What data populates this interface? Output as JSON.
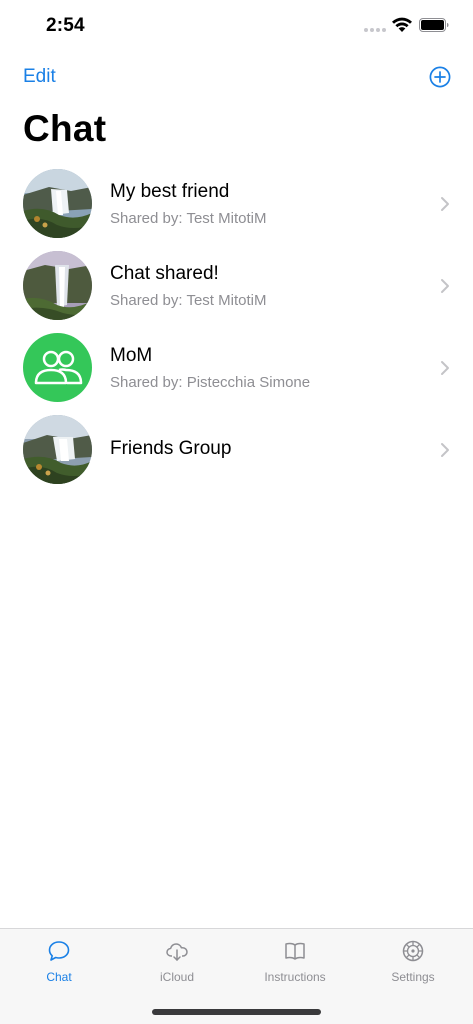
{
  "status_bar": {
    "time": "2:54"
  },
  "nav": {
    "edit_label": "Edit",
    "add_icon": "plus-circle-icon",
    "accent_color": "#1a80e6"
  },
  "title": "Chat",
  "chats": [
    {
      "name": "My best friend",
      "shared_by": "Shared by: Test MitotiM",
      "avatar": "waterfall-photo"
    },
    {
      "name": "Chat shared!",
      "shared_by": "Shared by: Test MitotiM",
      "avatar": "waterfall-photo"
    },
    {
      "name": "MoM",
      "shared_by": "Shared by: Pistecchia Simone",
      "avatar": "group-icon",
      "avatar_color": "#34c759"
    },
    {
      "name": "Friends Group",
      "shared_by": "",
      "avatar": "waterfall-photo"
    }
  ],
  "tabs": [
    {
      "label": "Chat",
      "icon": "chat-bubble-icon",
      "active": true
    },
    {
      "label": "iCloud",
      "icon": "cloud-download-icon",
      "active": false
    },
    {
      "label": "Instructions",
      "icon": "book-icon",
      "active": false
    },
    {
      "label": "Settings",
      "icon": "gear-icon",
      "active": false
    }
  ]
}
